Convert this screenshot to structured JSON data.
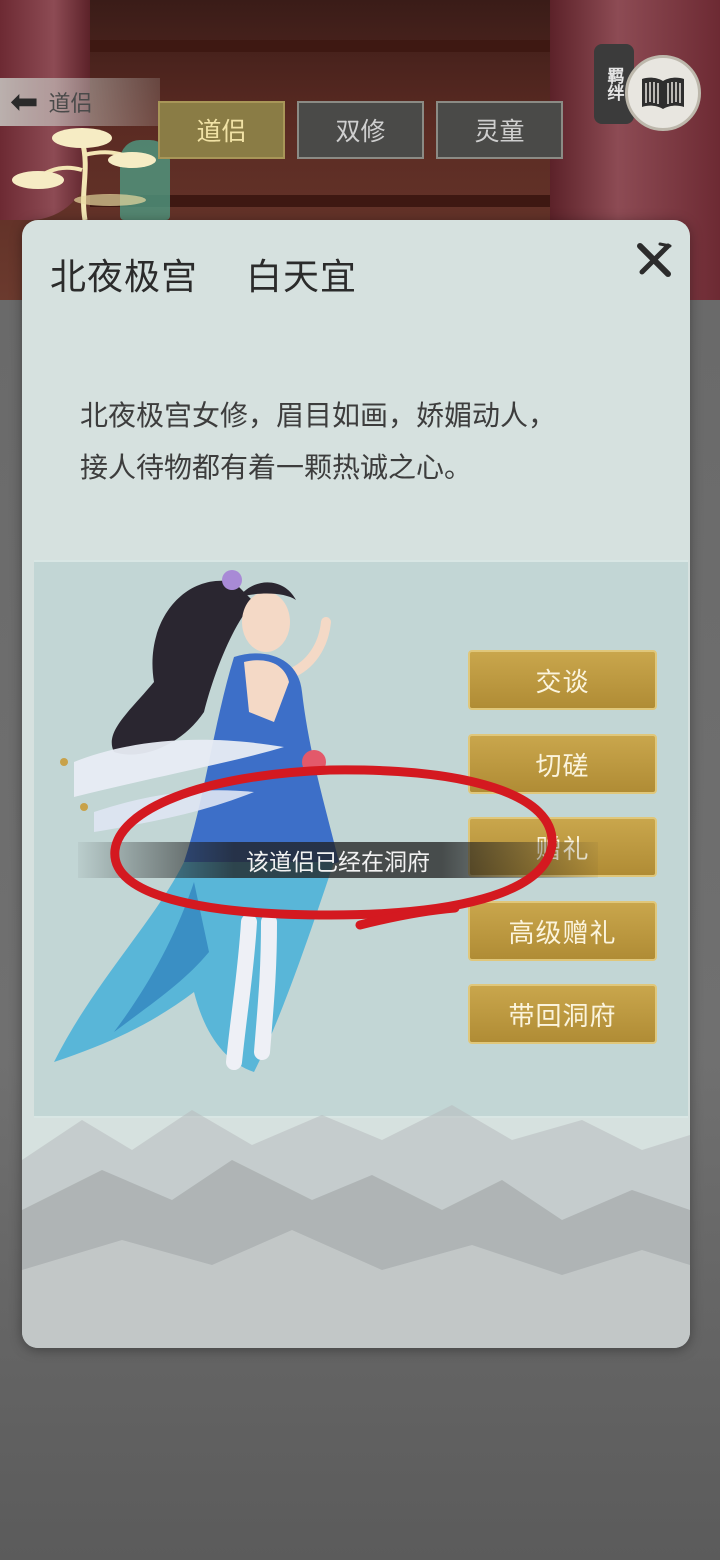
{
  "nav": {
    "back_label": "道侣",
    "tabs": [
      {
        "label": "道侣",
        "state": "active"
      },
      {
        "label": "双修",
        "state": "inactive"
      },
      {
        "label": "灵童",
        "state": "inactive"
      }
    ],
    "bond_label": "羁绊",
    "bond_icon": "book-icon"
  },
  "panel": {
    "sect": "北夜极宫",
    "name": "白天宜",
    "close_icon": "close-icon",
    "description_line1": "北夜极宫女修，眉目如画，娇媚动人，",
    "description_line2": "接人待物都有着一颗热诚之心。",
    "actions": [
      "交谈",
      "切磋",
      "赠礼",
      "高级赠礼",
      "带回洞府"
    ]
  },
  "toast": "该道侣已经在洞府",
  "colors": {
    "gold_button": "#b8953e",
    "panel_bg": "#d6e1df",
    "annotation_red": "#d41920"
  }
}
